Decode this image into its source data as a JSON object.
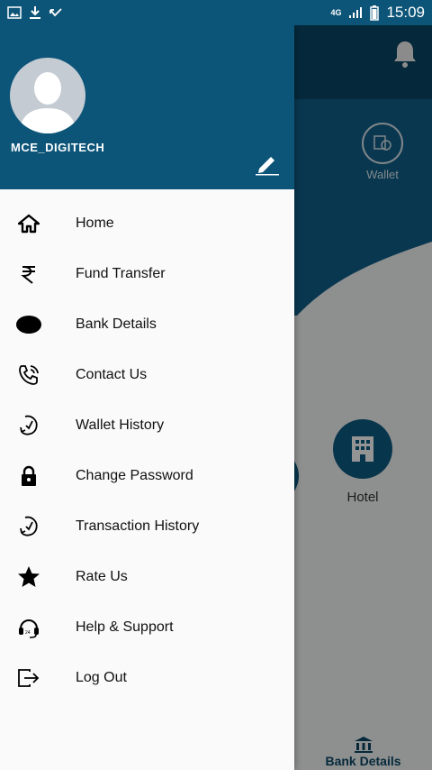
{
  "status_bar": {
    "network": "4G",
    "time": "15:09"
  },
  "background_app": {
    "wallet_label": "Wallet",
    "hotel_label": "Hotel",
    "bottom_tab_label": "Bank Details"
  },
  "drawer": {
    "username": "MCE_DIGITECH",
    "items": [
      {
        "label": "Home",
        "icon": "home-icon"
      },
      {
        "label": "Fund Transfer",
        "icon": "rupee-icon"
      },
      {
        "label": "Bank Details",
        "icon": "ellipse-icon"
      },
      {
        "label": "Contact Us",
        "icon": "phone-ringing-icon"
      },
      {
        "label": "Wallet History",
        "icon": "history-icon"
      },
      {
        "label": "Change Password",
        "icon": "lock-icon"
      },
      {
        "label": "Transaction History",
        "icon": "history-icon"
      },
      {
        "label": "Rate Us",
        "icon": "star-icon"
      },
      {
        "label": "Help & Support",
        "icon": "headset-icon"
      },
      {
        "label": "Log Out",
        "icon": "logout-icon"
      }
    ]
  },
  "colors": {
    "primary": "#0d5578",
    "drawer_bg": "#fafafa"
  }
}
